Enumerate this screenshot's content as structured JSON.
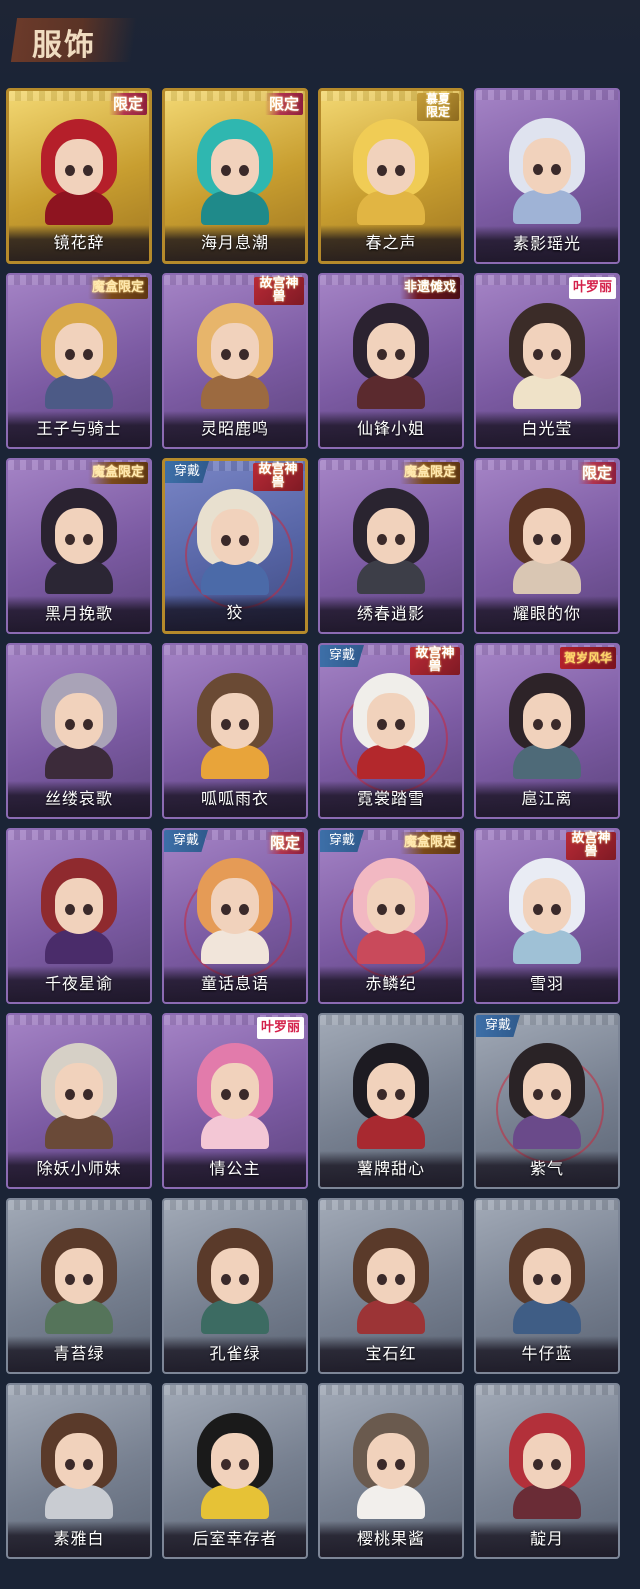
{
  "header": {
    "title": "服饰"
  },
  "badges": {
    "limited": "限定",
    "magicbox": "魔盒限定",
    "palace": "故宫神兽",
    "heritage": "非遗傩戏",
    "collab": "叶罗丽",
    "season": "慕夏限定",
    "festival": "贺岁风华",
    "worn": "穿戴"
  },
  "cards": [
    {
      "name": "镜花辞",
      "frame": "gold",
      "badge": "limited",
      "hair": "#b51f2a",
      "cloth": "#8e1420"
    },
    {
      "name": "海月息潮",
      "frame": "gold",
      "badge": "limited",
      "hair": "#2fb7b0",
      "cloth": "#1f8a8a"
    },
    {
      "name": "春之声",
      "frame": "gold",
      "badge": "season",
      "hair": "#f0cc55",
      "cloth": "#e1b543"
    },
    {
      "name": "素影瑶光",
      "frame": "purple",
      "badge": "",
      "hair": "#dfe3ef",
      "cloth": "#9fb3d6"
    },
    {
      "name": "王子与骑士",
      "frame": "purple",
      "badge": "magicbox",
      "hair": "#d8a84a",
      "cloth": "#4c5a86"
    },
    {
      "name": "灵昭鹿鸣",
      "frame": "purple",
      "badge": "palace",
      "hair": "#e7b56b",
      "cloth": "#9c6a40"
    },
    {
      "name": "仙锋小姐",
      "frame": "purple",
      "badge": "heritage",
      "hair": "#2b2230",
      "cloth": "#5b2a2e"
    },
    {
      "name": "白光莹",
      "frame": "purple",
      "badge": "collab",
      "hair": "#3b2c28",
      "cloth": "#efe2c8"
    },
    {
      "name": "黑月挽歌",
      "frame": "purple",
      "badge": "magicbox",
      "hair": "#2a2230",
      "cloth": "#2b2634"
    },
    {
      "name": "狡",
      "frame": "blue",
      "badge": "palace",
      "worn": true,
      "hair": "#e8e0cf",
      "cloth": "#4b6aa8"
    },
    {
      "name": "绣春逍影",
      "frame": "purple",
      "badge": "magicbox",
      "hair": "#2a2430",
      "cloth": "#3d3e48"
    },
    {
      "name": "耀眼的你",
      "frame": "purple",
      "badge": "limited",
      "hair": "#5a3424",
      "cloth": "#d9c6b3"
    },
    {
      "name": "丝缕哀歌",
      "frame": "purple",
      "badge": "",
      "hair": "#a9a3b7",
      "cloth": "#3c2b3a"
    },
    {
      "name": "呱呱雨衣",
      "frame": "purple",
      "badge": "",
      "hair": "#6a4a34",
      "cloth": "#e8a43a"
    },
    {
      "name": "霓裳踏雪",
      "frame": "purple",
      "badge": "palace",
      "worn": true,
      "hair": "#f0eeea",
      "cloth": "#b3282c"
    },
    {
      "name": "扈江离",
      "frame": "purple",
      "badge": "festival",
      "hair": "#2d2328",
      "cloth": "#4e6a78"
    },
    {
      "name": "千夜星谕",
      "frame": "purple",
      "badge": "",
      "hair": "#8f2a2e",
      "cloth": "#4a2c6a"
    },
    {
      "name": "童话息语",
      "frame": "purple",
      "badge": "limited",
      "worn": true,
      "hair": "#e59b56",
      "cloth": "#f1e5da"
    },
    {
      "name": "赤鳞纪",
      "frame": "purple",
      "badge": "magicbox",
      "worn": true,
      "hair": "#f2b8c2",
      "cloth": "#c94a5b"
    },
    {
      "name": "雪羽",
      "frame": "purple",
      "badge": "palace",
      "hair": "#e9ecf4",
      "cloth": "#9fc1d6"
    },
    {
      "name": "除妖小师妹",
      "frame": "purple",
      "badge": "",
      "hair": "#d6d0c6",
      "cloth": "#6a4a38"
    },
    {
      "name": "情公主",
      "frame": "purple",
      "badge": "collab",
      "hair": "#e27bab",
      "cloth": "#f3c7d5"
    },
    {
      "name": "薯牌甜心",
      "frame": "gray",
      "badge": "",
      "hair": "#1d1b22",
      "cloth": "#a82930"
    },
    {
      "name": "紫气",
      "frame": "gray",
      "badge": "",
      "worn": true,
      "hair": "#2a2326",
      "cloth": "#6a4a8a"
    },
    {
      "name": "青苔绿",
      "frame": "gray",
      "badge": "",
      "hair": "#5a3a2a",
      "cloth": "#55745a"
    },
    {
      "name": "孔雀绿",
      "frame": "gray",
      "badge": "",
      "hair": "#5a3a2a",
      "cloth": "#3c6b62"
    },
    {
      "name": "宝石红",
      "frame": "gray",
      "badge": "",
      "hair": "#5a3a2a",
      "cloth": "#9c3436"
    },
    {
      "name": "牛仔蓝",
      "frame": "gray",
      "badge": "",
      "hair": "#5a3a2a",
      "cloth": "#3f5d85"
    },
    {
      "name": "素雅白",
      "frame": "gray",
      "badge": "",
      "hair": "#5a3a2a",
      "cloth": "#c9ccd2"
    },
    {
      "name": "后室幸存者",
      "frame": "gray",
      "badge": "",
      "hair": "#1a1a1a",
      "cloth": "#e6c236"
    },
    {
      "name": "樱桃果酱",
      "frame": "gray",
      "badge": "",
      "hair": "#6a5a4e",
      "cloth": "#f2efec"
    },
    {
      "name": "靛月",
      "frame": "gray",
      "badge": "",
      "hair": "#b3303a",
      "cloth": "#6a2c36"
    }
  ]
}
